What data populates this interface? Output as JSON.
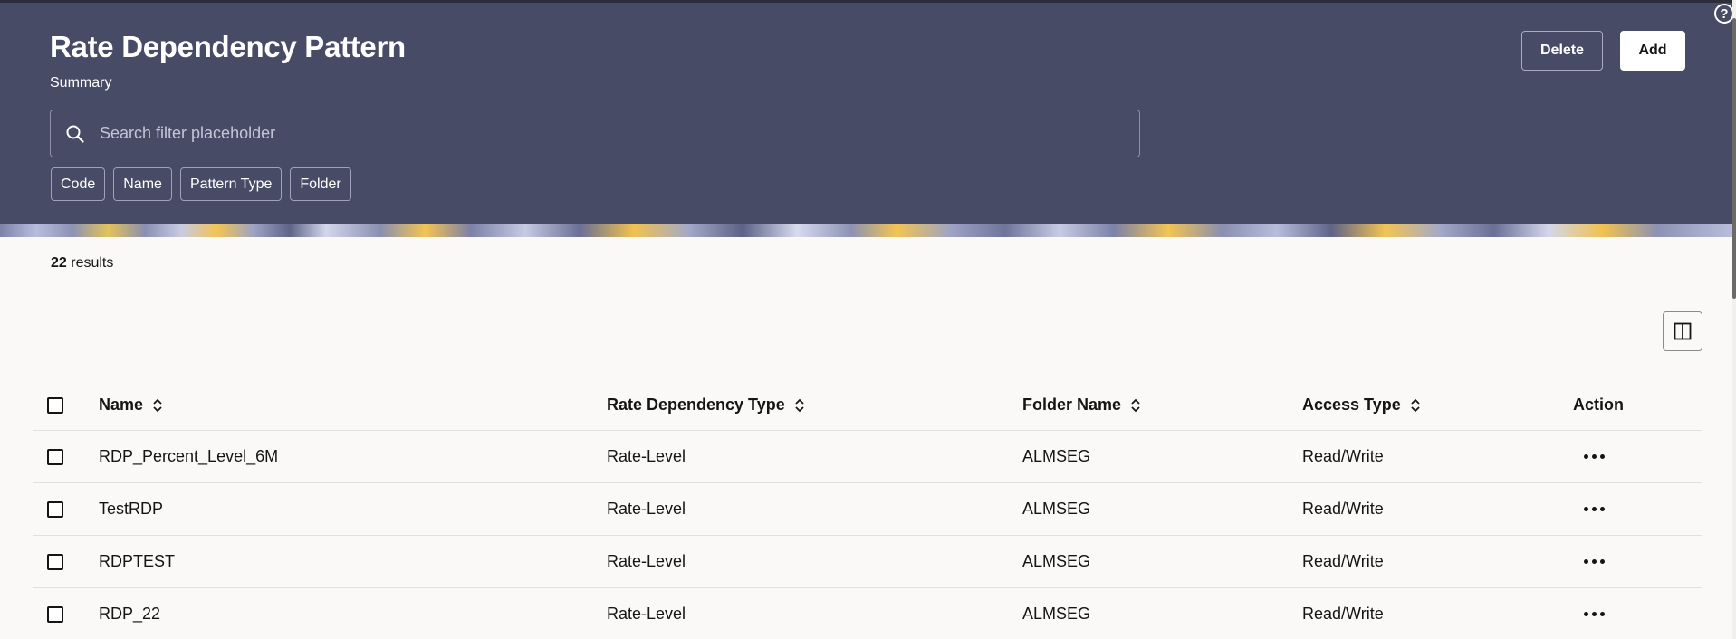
{
  "header": {
    "title": "Rate Dependency Pattern",
    "subtitle": "Summary",
    "delete_label": "Delete",
    "add_label": "Add",
    "help_glyph": "?"
  },
  "search": {
    "placeholder": "Search filter placeholder",
    "value": ""
  },
  "filter_chips": [
    "Code",
    "Name",
    "Pattern Type",
    "Folder"
  ],
  "results": {
    "count": "22",
    "label": "results"
  },
  "table": {
    "columns": [
      "Name",
      "Rate Dependency Type",
      "Folder Name",
      "Access Type",
      "Action"
    ],
    "rows": [
      {
        "name": "RDP_Percent_Level_6M",
        "type": "Rate-Level",
        "folder": "ALMSEG",
        "access": "Read/Write"
      },
      {
        "name": "TestRDP",
        "type": "Rate-Level",
        "folder": "ALMSEG",
        "access": "Read/Write"
      },
      {
        "name": "RDPTEST",
        "type": "Rate-Level",
        "folder": "ALMSEG",
        "access": "Read/Write"
      },
      {
        "name": "RDP_22",
        "type": "Rate-Level",
        "folder": "ALMSEG",
        "access": "Read/Write"
      }
    ]
  },
  "icons": {
    "search": "search-icon",
    "help": "help-icon",
    "sort": "sort-icon",
    "more": "more-options-icon",
    "columns": "column-layout-icon"
  },
  "colors": {
    "header_bg": "#474b66",
    "page_bg": "#faf9f7",
    "text": "#161513"
  }
}
